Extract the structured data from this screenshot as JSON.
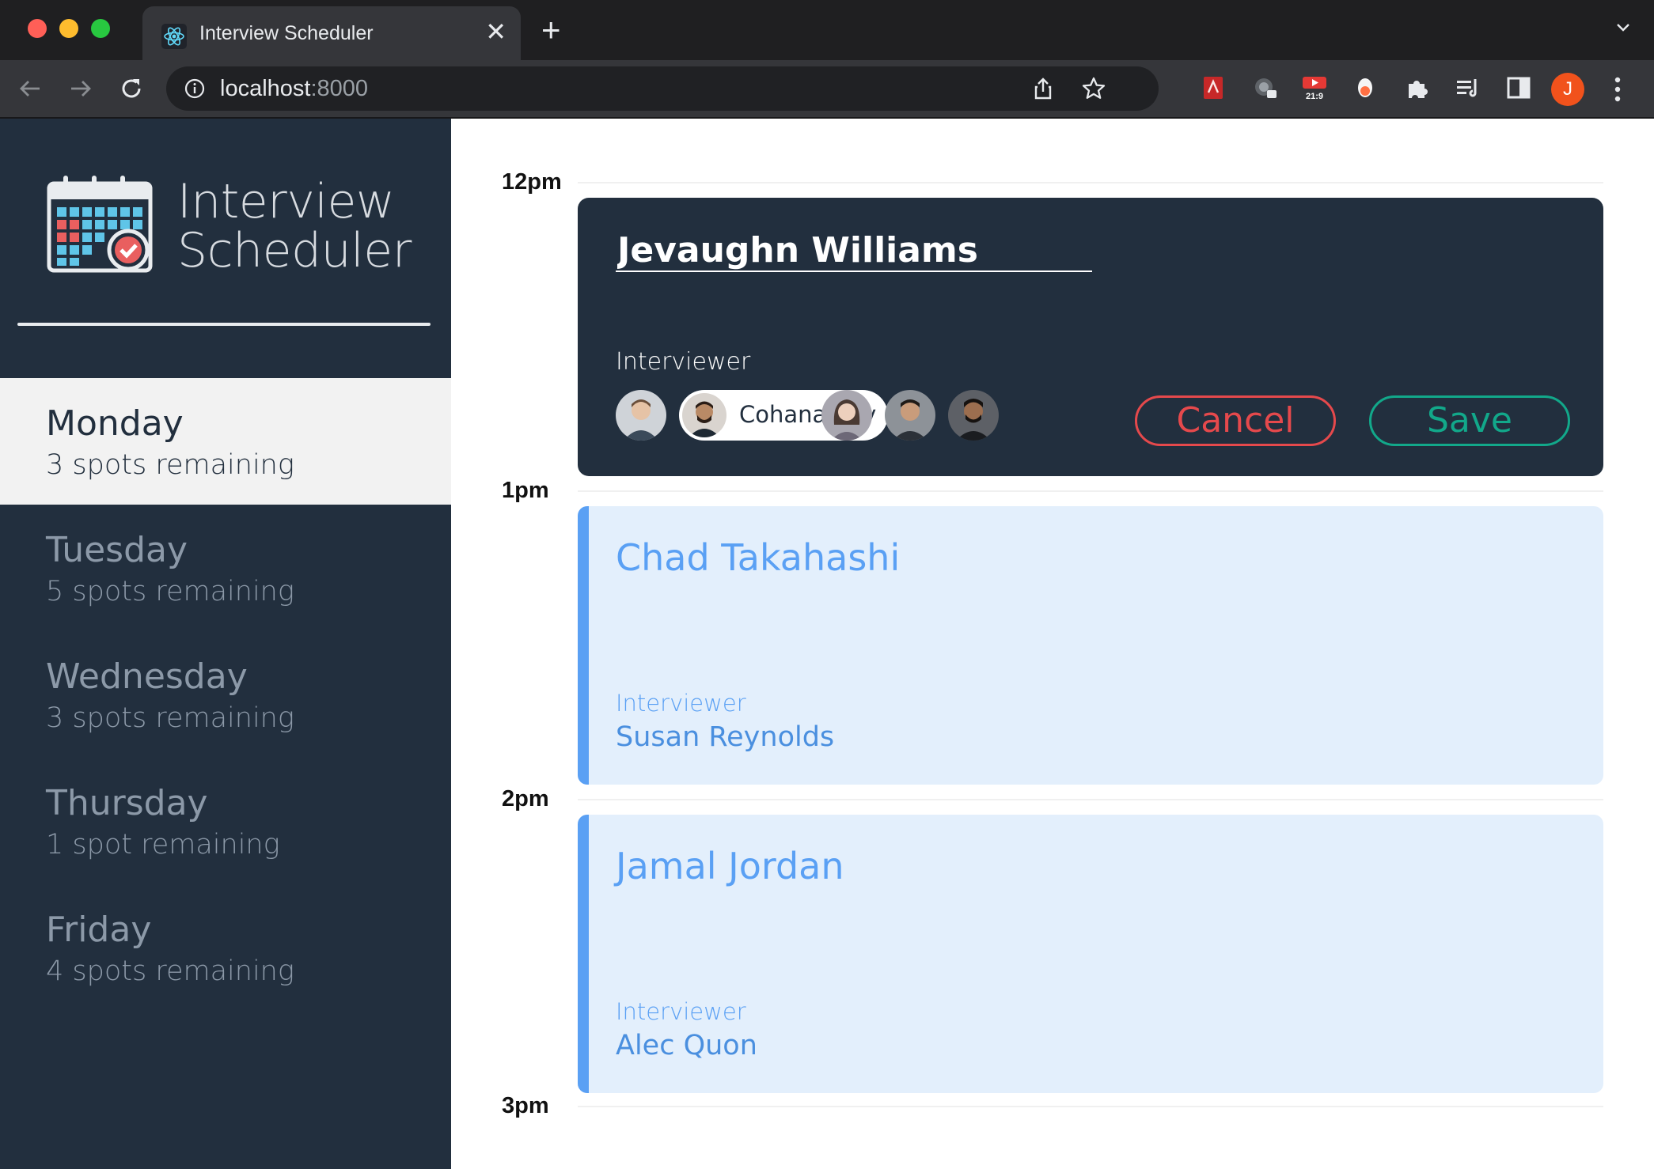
{
  "browser": {
    "tab_title": "Interview Scheduler",
    "close_glyph": "✕",
    "new_tab_glyph": "+",
    "url_host": "localhost",
    "url_port": ":8000",
    "profile_initial": "J",
    "extensions": [
      "pdf-extension-icon",
      "tab-cast-extension-icon",
      "aspect-ratio-extension-icon",
      "egg-extension-icon",
      "puzzle-extensions-icon",
      "reading-list-icon",
      "sidepanel-icon"
    ],
    "extension_badge": "21:9"
  },
  "sidebar": {
    "logo_line1": "Interview",
    "logo_line2": "Scheduler",
    "days": [
      {
        "name": "Monday",
        "spots": "3 spots remaining",
        "selected": true
      },
      {
        "name": "Tuesday",
        "spots": "5 spots remaining",
        "selected": false
      },
      {
        "name": "Wednesday",
        "spots": "3 spots remaining",
        "selected": false
      },
      {
        "name": "Thursday",
        "spots": "1 spot remaining",
        "selected": false
      },
      {
        "name": "Friday",
        "spots": "4 spots remaining",
        "selected": false
      }
    ]
  },
  "schedule": {
    "hours": [
      "12pm",
      "1pm",
      "2pm",
      "3pm"
    ],
    "form": {
      "student_name": "Jevaughn Williams",
      "interviewer_label": "Interviewer",
      "selected_interviewer": "Cohana Roy",
      "cancel_label": "Cancel",
      "save_label": "Save"
    },
    "appointments": [
      {
        "student": "Chad Takahashi",
        "interviewer_label": "Interviewer",
        "interviewer": "Susan Reynolds"
      },
      {
        "student": "Jamal Jordan",
        "interviewer_label": "Interviewer",
        "interviewer": "Alec Quon"
      }
    ]
  },
  "colors": {
    "sidebar_bg": "#222f3e",
    "selected_day_bg": "#f2f2f2",
    "cancel": "#e5494c",
    "save": "#12a88a",
    "appointment_bg": "#e3effc",
    "appointment_accent": "#5aa0f4"
  }
}
